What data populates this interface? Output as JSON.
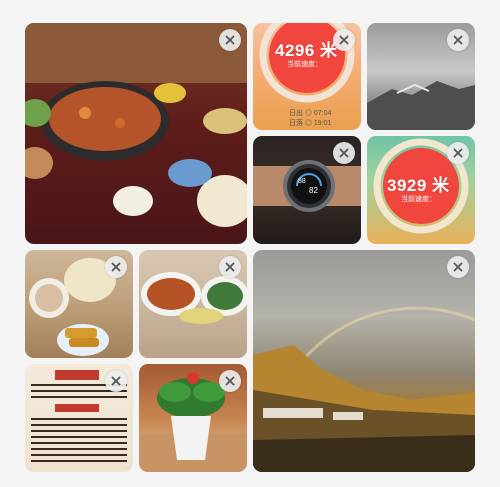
{
  "tiles": [
    {
      "id": "hotpot-dinner",
      "remove_label": "×"
    },
    {
      "id": "distance-4296",
      "distance": "4296 米",
      "label": "当前速度：",
      "sub1": "日出 ◎ 07:04",
      "sub2": "日落 ◎ 19:01",
      "remove_label": "×"
    },
    {
      "id": "misty-mountain",
      "remove_label": "×"
    },
    {
      "id": "smartwatch",
      "watch_a": "88",
      "watch_b": "82",
      "remove_label": "×"
    },
    {
      "id": "distance-3929",
      "distance": "3929 米",
      "label": "当前速度：",
      "remove_label": "×"
    },
    {
      "id": "breakfast",
      "remove_label": "×"
    },
    {
      "id": "dishes",
      "remove_label": "×"
    },
    {
      "id": "rainbow-landscape",
      "remove_label": "×"
    },
    {
      "id": "menu-board",
      "remove_label": "×"
    },
    {
      "id": "potted-plant",
      "remove_label": "×"
    }
  ],
  "colors": {
    "remove_button_bg": "#ebebeb",
    "remove_icon": "#555555",
    "ring_red": "#f0463d"
  }
}
